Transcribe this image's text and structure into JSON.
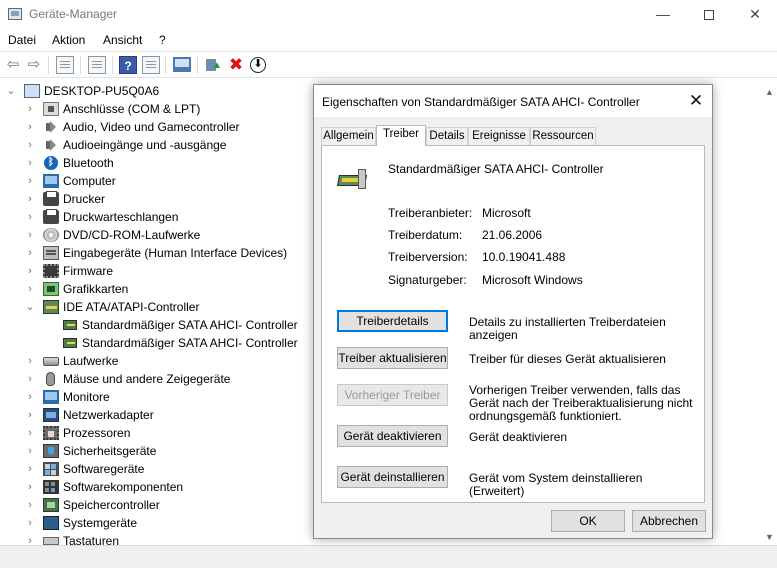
{
  "window": {
    "title": "Geräte-Manager",
    "minimize_glyph": "—",
    "close_glyph": "✕"
  },
  "menu": {
    "items": [
      "Datei",
      "Aktion",
      "Ansicht",
      "?"
    ]
  },
  "toolbar": {
    "back_glyph": "⇦",
    "forward_glyph": "⇨",
    "help_glyph": "?",
    "remove_glyph": "✖",
    "download_glyph": "⬇"
  },
  "tree": {
    "root": "DESKTOP-PU5Q0A6",
    "collapsed_glyph": "›",
    "expanded_glyph": "⌄",
    "bluetooth_glyph": "ᛒ",
    "categories": [
      "Anschlüsse (COM & LPT)",
      "Audio, Video und Gamecontroller",
      "Audioeingänge und -ausgänge",
      "Bluetooth",
      "Computer",
      "Drucker",
      "Druckwarteschlangen",
      "DVD/CD-ROM-Laufwerke",
      "Eingabegeräte (Human Interface Devices)",
      "Firmware",
      "Grafikkarten",
      "IDE ATA/ATAPI-Controller",
      "Laufwerke",
      "Mäuse und andere Zeigegeräte",
      "Monitore",
      "Netzwerkadapter",
      "Prozessoren",
      "Sicherheitsgeräte",
      "Softwaregeräte",
      "Softwarekomponenten",
      "Speichercontroller",
      "Systemgeräte",
      "Tastaturen"
    ],
    "ide_children": [
      "Standardmäßiger SATA AHCI- Controller",
      "Standardmäßiger SATA AHCI- Controller"
    ],
    "scroll_up_glyph": "▲",
    "scroll_down_glyph": "▼"
  },
  "dialog": {
    "title": "Eigenschaften von Standardmäßiger SATA AHCI- Controller",
    "close_glyph": "✕",
    "tabs": [
      "Allgemein",
      "Treiber",
      "Details",
      "Ereignisse",
      "Ressourcen"
    ],
    "active_tab": "Treiber",
    "device_name": "Standardmäßiger SATA AHCI- Controller",
    "properties": [
      {
        "label": "Treiberanbieter:",
        "value": "Microsoft"
      },
      {
        "label": "Treiberdatum:",
        "value": "21.06.2006"
      },
      {
        "label": "Treiberversion:",
        "value": "10.0.19041.488"
      },
      {
        "label": "Signaturgeber:",
        "value": "Microsoft Windows"
      }
    ],
    "actions": [
      {
        "label": "Treiberdetails",
        "description": "Details zu installierten Treiberdateien anzeigen"
      },
      {
        "label": "Treiber aktualisieren",
        "description": "Treiber für dieses Gerät aktualisieren"
      },
      {
        "label": "Vorheriger Treiber",
        "description": "Vorherigen Treiber verwenden, falls das Gerät nach der Treiberaktualisierung nicht ordnungsgemäß funktioniert."
      },
      {
        "label": "Gerät deaktivieren",
        "description": "Gerät deaktivieren"
      },
      {
        "label": "Gerät deinstallieren",
        "description": "Gerät vom System deinstallieren (Erweitert)"
      }
    ],
    "ok_label": "OK",
    "cancel_label": "Abbrechen"
  }
}
